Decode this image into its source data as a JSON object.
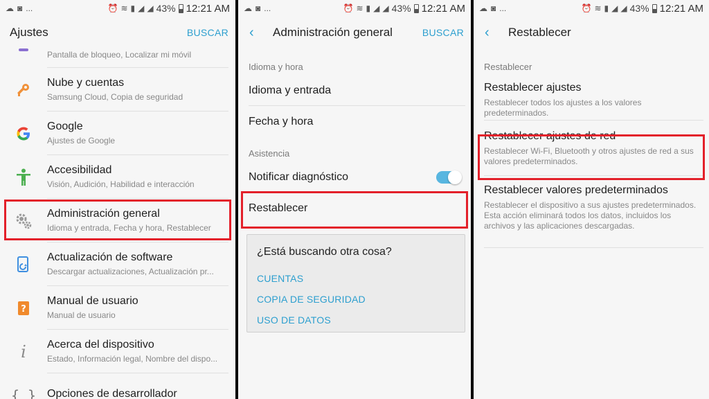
{
  "status": {
    "battery": "43%",
    "time": "12:21 AM",
    "dots": "..."
  },
  "panel1": {
    "title": "Ajustes",
    "search": "BUSCAR",
    "partial_subtitle": "Pantalla de bloqueo, Localizar mi móvil",
    "items": [
      {
        "title": "Nube y cuentas",
        "subtitle": "Samsung Cloud, Copia de seguridad",
        "icon": "key-icon"
      },
      {
        "title": "Google",
        "subtitle": "Ajustes de Google",
        "icon": "google-icon"
      },
      {
        "title": "Accesibilidad",
        "subtitle": "Visión, Audición, Habilidad e interacción",
        "icon": "accessibility-icon"
      },
      {
        "title": "Administración general",
        "subtitle": "Idioma y entrada, Fecha y hora, Restablecer",
        "icon": "gears-icon"
      },
      {
        "title": "Actualización de software",
        "subtitle": "Descargar actualizaciones, Actualización pr...",
        "icon": "software-update-icon"
      },
      {
        "title": "Manual de usuario",
        "subtitle": "Manual de usuario",
        "icon": "manual-icon"
      },
      {
        "title": "Acerca del dispositivo",
        "subtitle": "Estado, Información legal, Nombre del dispo...",
        "icon": "info-icon"
      },
      {
        "title": "Opciones de desarrollador",
        "subtitle": "",
        "icon": "developer-braces-icon"
      }
    ]
  },
  "panel2": {
    "title": "Administración general",
    "search": "BUSCAR",
    "section1": "Idioma y hora",
    "item1": "Idioma y entrada",
    "item2": "Fecha y hora",
    "section2": "Asistencia",
    "item3": "Notificar diagnóstico",
    "item4": "Restablecer",
    "looking": {
      "question": "¿Está buscando otra cosa?",
      "links": [
        "CUENTAS",
        "COPIA DE SEGURIDAD",
        "USO DE DATOS"
      ]
    }
  },
  "panel3": {
    "title": "Restablecer",
    "section": "Restablecer",
    "items": [
      {
        "title": "Restablecer ajustes",
        "subtitle": "Restablecer todos los ajustes a los valores predeterminados."
      },
      {
        "title": "Restablecer ajustes de red",
        "subtitle": "Restablecer Wi-Fi, Bluetooth y otros ajustes de red a sus valores predeterminados."
      },
      {
        "title": "Restablecer valores predeterminados",
        "subtitle": "Restablecer el dispositivo a sus ajustes predeterminados. Esta acción eliminará todos los datos, incluidos los archivos y las aplicaciones descargadas."
      }
    ]
  },
  "colors": {
    "accent": "#2d9fcf",
    "highlight": "#e3202a",
    "key_icon": "#f0913a",
    "google_icon": "#4285f4",
    "accessibility_icon": "#4caf50",
    "update_icon": "#3f8fe0",
    "manual_icon": "#f08a2c"
  }
}
